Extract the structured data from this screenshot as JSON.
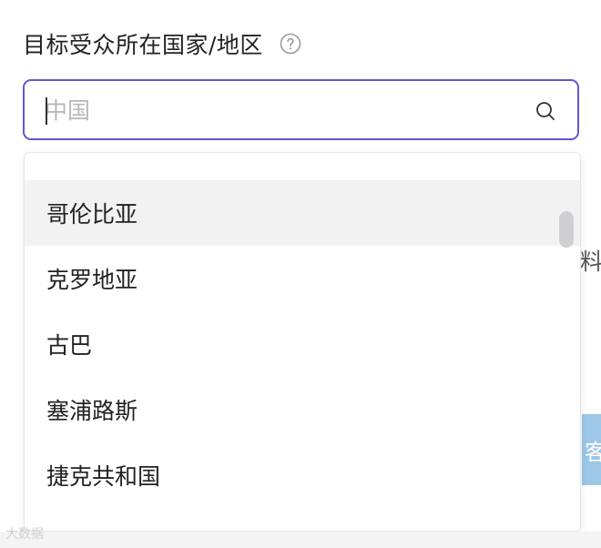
{
  "field": {
    "label": "目标受众所在国家/地区",
    "help_icon": "question-circle-icon"
  },
  "search": {
    "placeholder": "中国",
    "value": "",
    "icon": "search-icon",
    "border_color": "#6f4fd6"
  },
  "dropdown": {
    "options": [
      {
        "label": "哥伦比亚",
        "active": true
      },
      {
        "label": "克罗地亚",
        "active": false
      },
      {
        "label": "古巴",
        "active": false
      },
      {
        "label": "塞浦路斯",
        "active": false
      },
      {
        "label": "捷克共和国",
        "active": false
      }
    ]
  },
  "background": {
    "text_fragment": "料",
    "button_fragment": "客"
  },
  "watermark": {
    "text": "大数据"
  }
}
